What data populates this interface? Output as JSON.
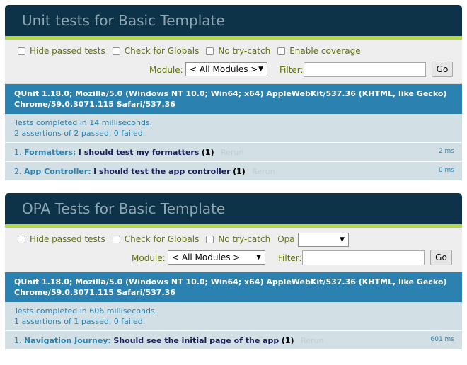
{
  "suites": [
    {
      "title": "Unit tests for Basic Template",
      "toolbar": {
        "hide_passed": "Hide passed tests",
        "check_globals": "Check for Globals",
        "no_try_catch": "No try-catch",
        "extra": "Enable coverage",
        "module_label": "Module:",
        "module_value": "< All Modules >",
        "filter_label": "Filter:",
        "go": "Go"
      },
      "user_agent": "QUnit 1.18.0; Mozilla/5.0 (Windows NT 10.0; Win64; x64) AppleWebKit/537.36 (KHTML, like Gecko) Chrome/59.0.3071.115 Safari/537.36",
      "result_line1": "Tests completed in 14 milliseconds.",
      "result_line2": "2 assertions of 2 passed, 0 failed.",
      "tests": [
        {
          "num": "1.",
          "module": "Formatters:",
          "name": "I should test my formatters",
          "count": "(1)",
          "rerun": "Rerun",
          "runtime": "2 ms"
        },
        {
          "num": "2.",
          "module": "App Controller:",
          "name": "I should test the app controller",
          "count": "(1)",
          "rerun": "Rerun",
          "runtime": "0 ms"
        }
      ]
    },
    {
      "title": "OPA Tests for Basic Template",
      "toolbar": {
        "hide_passed": "Hide passed tests",
        "check_globals": "Check for Globals",
        "no_try_catch": "No try-catch",
        "extra": "Opa speed:",
        "speed_value": "",
        "module_label": "Module:",
        "module_value": "< All Modules >",
        "filter_label": "Filter:",
        "go": "Go"
      },
      "user_agent": "QUnit 1.18.0; Mozilla/5.0 (Windows NT 10.0; Win64; x64) AppleWebKit/537.36 (KHTML, like Gecko) Chrome/59.0.3071.115 Safari/537.36",
      "result_line1": "Tests completed in 606 milliseconds.",
      "result_line2": "1 assertions of 1 passed, 0 failed.",
      "tests": [
        {
          "num": "1.",
          "module": "Navigation Journey:",
          "name": "Should see the initial page of the app",
          "count": "(1)",
          "rerun": "Rerun",
          "runtime": "601 ms"
        }
      ]
    }
  ]
}
